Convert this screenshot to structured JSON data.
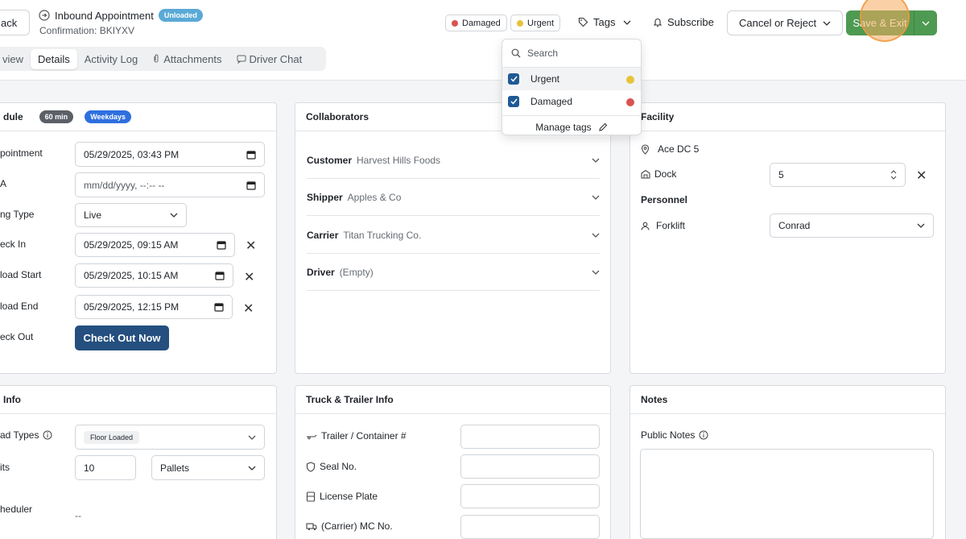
{
  "header": {
    "back_label": "ack",
    "title": "Inbound Appointment",
    "status_badge": "Unloaded",
    "confirmation": "Confirmation: BKIYXV",
    "tabs": [
      "view",
      "Details",
      "Activity Log",
      "Attachments",
      "Driver Chat"
    ],
    "active_tab": "Details",
    "tag_chips": [
      {
        "label": "Damaged",
        "color": "#d9534f"
      },
      {
        "label": "Urgent",
        "color": "#e8c33a"
      }
    ],
    "tags_label": "Tags",
    "subscribe_label": "Subscribe",
    "cancel_label": "Cancel or Reject",
    "save_label": "Save & Exit"
  },
  "tags_dropdown": {
    "search_placeholder": "Search",
    "items": [
      {
        "label": "Urgent",
        "checked": true,
        "color": "#e8c33a"
      },
      {
        "label": "Damaged",
        "checked": true,
        "color": "#d9534f"
      }
    ],
    "manage_label": "Manage tags"
  },
  "schedule": {
    "title": "dule",
    "duration_badge": "60 min",
    "days_badge": "Weekdays",
    "rows": [
      {
        "label": "pointment",
        "value": "05/29/2025, 03:43 PM"
      },
      {
        "label": "A",
        "value": "mm/dd/yyyy, --:-- --"
      },
      {
        "label": "ng Type",
        "value": "Live"
      },
      {
        "label": "eck In",
        "value": "05/29/2025, 09:15 AM"
      },
      {
        "label": "load Start",
        "value": "05/29/2025, 10:15 AM"
      },
      {
        "label": "load End",
        "value": "05/29/2025, 12:15 PM"
      },
      {
        "label": "eck Out",
        "value": "Check Out Now"
      }
    ]
  },
  "collaborators": {
    "title": "Collaborators",
    "rows": [
      {
        "label": "Customer",
        "value": "Harvest Hills Foods"
      },
      {
        "label": "Shipper",
        "value": "Apples & Co"
      },
      {
        "label": "Carrier",
        "value": "Titan Trucking Co."
      },
      {
        "label": "Driver",
        "value": "(Empty)"
      }
    ]
  },
  "facility": {
    "title": "Facility",
    "location": "Ace DC 5",
    "dock_label": "Dock",
    "dock_value": "5",
    "personnel_title": "Personnel",
    "forklift_label": "Forklift",
    "forklift_value": "Conrad"
  },
  "load_info": {
    "title": "Info",
    "load_types_label": "ad Types",
    "load_types_value": "Floor Loaded",
    "units_label": "its",
    "units_value": "10",
    "units_type": "Pallets",
    "scheduler_label": "heduler",
    "scheduler_value": "--"
  },
  "truck_info": {
    "title": "Truck & Trailer Info",
    "fields": [
      "Trailer / Container #",
      "Seal No.",
      "License Plate",
      "(Carrier) MC No."
    ]
  },
  "notes": {
    "title": "Notes",
    "public_label": "Public Notes"
  }
}
